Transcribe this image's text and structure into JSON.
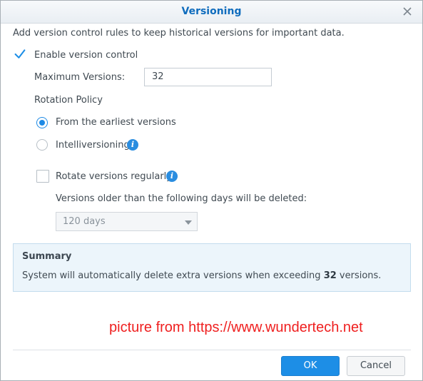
{
  "dialog": {
    "title": "Versioning"
  },
  "description": "Add version control rules to keep historical versions for important data.",
  "enable_version_control": {
    "label": "Enable version control",
    "checked": true
  },
  "max_versions": {
    "label": "Maximum Versions:",
    "value": "32"
  },
  "rotation_policy": {
    "label": "Rotation Policy",
    "options": [
      {
        "label": "From the earliest versions",
        "selected": true
      },
      {
        "label": "Intelliversioning",
        "selected": false
      }
    ]
  },
  "rotate_regularly": {
    "label": "Rotate versions regularly",
    "checked": false
  },
  "deletion": {
    "label": "Versions older than the following days will be deleted:",
    "selected": "120 days"
  },
  "summary": {
    "heading": "Summary",
    "text_before": "System will automatically delete extra versions when exceeding ",
    "count": "32",
    "text_after": " versions."
  },
  "watermark": "picture from https://www.wundertech.net",
  "buttons": {
    "ok": "OK",
    "cancel": "Cancel"
  },
  "icons": {
    "close": "close-icon",
    "check": "check-icon",
    "info": "info-icon",
    "dropdown": "chevron-down-icon"
  },
  "colors": {
    "accent": "#1d8ee6",
    "title": "#0f6cbd",
    "summary_bg": "#ecf5fb",
    "watermark": "#ef1f1f"
  }
}
